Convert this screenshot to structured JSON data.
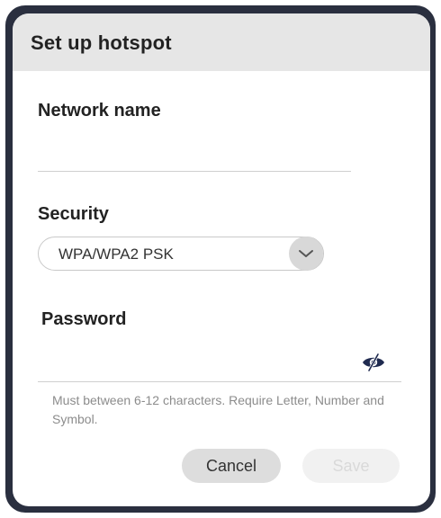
{
  "dialog": {
    "title": "Set up hotspot"
  },
  "network_name": {
    "label": "Network name",
    "value": "",
    "placeholder": ""
  },
  "security": {
    "label": "Security",
    "selected": "WPA/WPA2 PSK",
    "icon": "chevron-down-icon"
  },
  "password": {
    "label": "Password",
    "value": "",
    "placeholder": "",
    "toggle_icon": "eye-slash-icon",
    "hint": "Must between 6-12 characters. Require Letter, Number and Symbol."
  },
  "actions": {
    "cancel_label": "Cancel",
    "save_label": "Save",
    "save_enabled": false
  },
  "colors": {
    "frame": "#2a2f3f",
    "header_bg": "#e6e6e6",
    "hint_text": "#8c8c8c",
    "icon": "#1f2a4f"
  }
}
